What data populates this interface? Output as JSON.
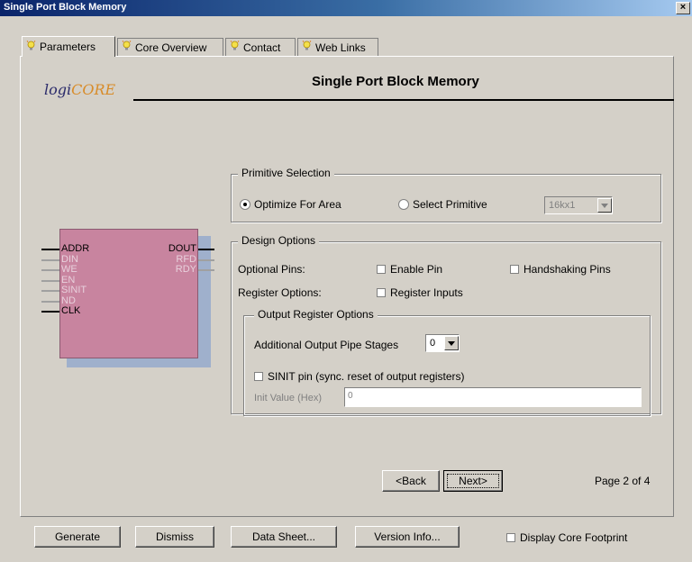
{
  "window": {
    "title": "Single Port Block Memory",
    "close_glyph": "×"
  },
  "tabs": [
    {
      "label": "Parameters",
      "icon": "lightbulb-icon",
      "active": true
    },
    {
      "label": "Core Overview",
      "icon": "lightbulb-icon",
      "active": false
    },
    {
      "label": "Contact",
      "icon": "lightbulb-icon",
      "active": false
    },
    {
      "label": "Web Links",
      "icon": "lightbulb-icon",
      "active": false
    }
  ],
  "header": {
    "title": "Single Port Block Memory",
    "logo_part1": "logi",
    "logo_part2": "CORE"
  },
  "block": {
    "left_pins": [
      {
        "label": "ADDR",
        "active": true
      },
      {
        "label": "DIN",
        "active": false
      },
      {
        "label": "WE",
        "active": false
      },
      {
        "label": "EN",
        "active": false
      },
      {
        "label": "SINIT",
        "active": false
      },
      {
        "label": "ND",
        "active": false
      },
      {
        "label": "CLK",
        "active": true
      }
    ],
    "right_pins": [
      {
        "label": "DOUT",
        "active": true
      },
      {
        "label": "RFD",
        "active": false
      },
      {
        "label": "RDY",
        "active": false
      }
    ]
  },
  "primitive_selection": {
    "legend": "Primitive Selection",
    "optimize_label": "Optimize For Area",
    "select_label": "Select Primitive",
    "selected": "optimize",
    "primitive_value": "16kx1"
  },
  "design_options": {
    "legend": "Design Options",
    "optional_pins_label": "Optional Pins:",
    "enable_pin_label": "Enable Pin",
    "handshaking_label": "Handshaking Pins",
    "register_options_label": "Register Options:",
    "register_inputs_label": "Register Inputs",
    "output_register": {
      "legend": "Output Register Options",
      "pipe_label": "Additional Output Pipe Stages",
      "pipe_value": "0",
      "sinit_label": "SINIT pin (sync. reset of output registers)",
      "init_label": "Init Value (Hex)",
      "init_value": "0"
    }
  },
  "nav": {
    "back_label": "<Back",
    "next_label": "Next>",
    "page_label": "Page 2 of 4"
  },
  "footer": {
    "generate_label": "Generate",
    "dismiss_label": "Dismiss",
    "datasheet_label": "Data Sheet...",
    "version_label": "Version Info...",
    "footprint_label": "Display Core Footprint"
  },
  "colors": {
    "block_fill": "#c8849f",
    "block_shadow": "#9fb0cc",
    "titlebar": "#0a246a"
  }
}
